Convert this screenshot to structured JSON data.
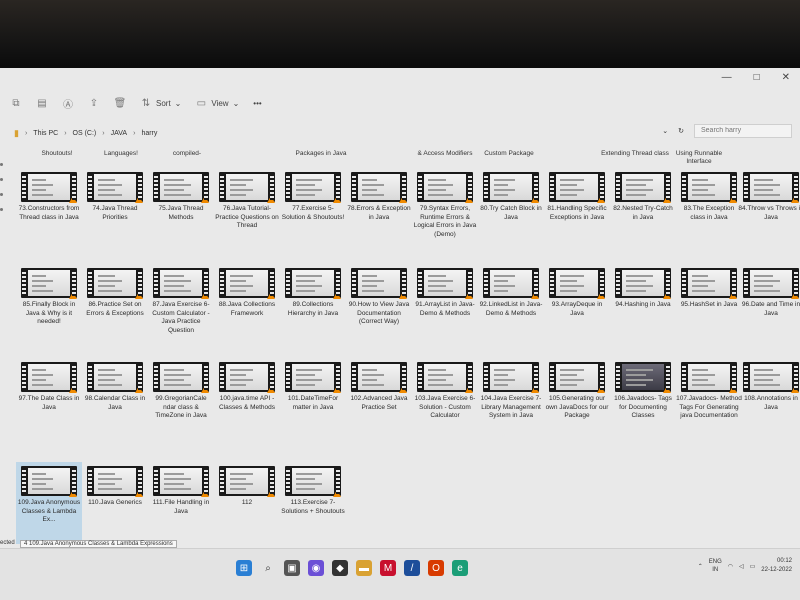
{
  "window": {
    "buttons": [
      "—",
      "□",
      "✕"
    ]
  },
  "toolbar": {
    "sort_label": "Sort",
    "view_label": "View",
    "more_label": "•••"
  },
  "address": {
    "crumbs": [
      "This PC",
      "OS (C:)",
      "JAVA",
      "harry"
    ],
    "search_placeholder": "Search harry"
  },
  "top_captions": [
    "Shoutouts!",
    "Languages!",
    "compiled-",
    "Packages in Java",
    "& Access Modifiers",
    "Custom Package",
    "Extending Thread class",
    "Using Runnable Interface"
  ],
  "rows": [
    [
      {
        "label": "73.Constructors from Thread class in Java",
        "dark": false
      },
      {
        "label": "74.Java Thread Priorities",
        "dark": false
      },
      {
        "label": "75.Java Thread Methods",
        "dark": false
      },
      {
        "label": "76.Java Tutorial- Practice Questions on Thread",
        "dark": false
      },
      {
        "label": "77.Exercise 5- Solution & Shoutouts!",
        "dark": false
      },
      {
        "label": "78.Errors & Exception in Java",
        "dark": false
      },
      {
        "label": "79.Syntax Errors, Runtime Errors & Logical Errors in Java (Demo)",
        "dark": false
      },
      {
        "label": "80.Try Catch Block in Java",
        "dark": false
      },
      {
        "label": "81.Handling Specific Exceptions in Java",
        "dark": false
      },
      {
        "label": "82.Nested Try-Catch in Java",
        "dark": false
      },
      {
        "label": "83.The Exception class in Java",
        "dark": false
      },
      {
        "label": "84.Throw vs Throws in Java",
        "dark": false
      }
    ],
    [
      {
        "label": "85.Finally Block in Java & Why is it needed!",
        "dark": false
      },
      {
        "label": "86.Practice Set on Errors & Exceptions",
        "dark": false
      },
      {
        "label": "87.Java Exercise 6- Custom Calculator - Java Practice Question",
        "dark": false
      },
      {
        "label": "88.Java Collections Framework",
        "dark": false
      },
      {
        "label": "89.Collections Hierarchy in Java",
        "dark": false
      },
      {
        "label": "90.How to View Java Documentation (Correct Way)",
        "dark": false
      },
      {
        "label": "91.ArrayList in Java- Demo & Methods",
        "dark": false
      },
      {
        "label": "92.LinkedList in Java- Demo & Methods",
        "dark": false
      },
      {
        "label": "93.ArrayDeque in Java",
        "dark": false
      },
      {
        "label": "94.Hashing in Java",
        "dark": false
      },
      {
        "label": "95.HashSet in Java",
        "dark": false
      },
      {
        "label": "96.Date and Time in Java",
        "dark": false
      }
    ],
    [
      {
        "label": "97.The Date Class in Java",
        "dark": false
      },
      {
        "label": "98.Calendar Class in Java",
        "dark": false
      },
      {
        "label": "99.GregorianCale ndar class & TimeZone in Java",
        "dark": false
      },
      {
        "label": "100.java.time API - Classes & Methods",
        "dark": false
      },
      {
        "label": "101.DateTimeFor matter in Java",
        "dark": false
      },
      {
        "label": "102.Advanced Java Practice Set",
        "dark": false
      },
      {
        "label": "103.Java Exercise 6- Solution - Custom Calculator",
        "dark": false
      },
      {
        "label": "104.Java Exercise 7- Library Management System in Java",
        "dark": false
      },
      {
        "label": "105.Generating our own JavaDocs for our Package",
        "dark": false
      },
      {
        "label": "106.Javadocs- Tags for Documenting Classes",
        "dark": true
      },
      {
        "label": "107.Javadocs- Method Tags For Generating java Documentation",
        "dark": false
      },
      {
        "label": "108.Annotations in Java",
        "dark": false
      }
    ],
    [
      {
        "label": "109.Java Anonymous Classes & Lambda Ex...",
        "dark": false,
        "selected": true
      },
      {
        "label": "110.Java Generics",
        "dark": false
      },
      {
        "label": "111.File Handling in Java",
        "dark": false
      },
      {
        "label": "112",
        "dark": false
      },
      {
        "label": "113.Exercise 7- Solutions + Shoutouts",
        "dark": false
      }
    ]
  ],
  "status": {
    "count_text": "ected",
    "selected_text": "4 109.Java Anonymous Classes & Lambda Expressions"
  },
  "tray": {
    "lang1": "ENG",
    "lang2": "IN",
    "time": "00:12",
    "date": "22-12-2022"
  }
}
